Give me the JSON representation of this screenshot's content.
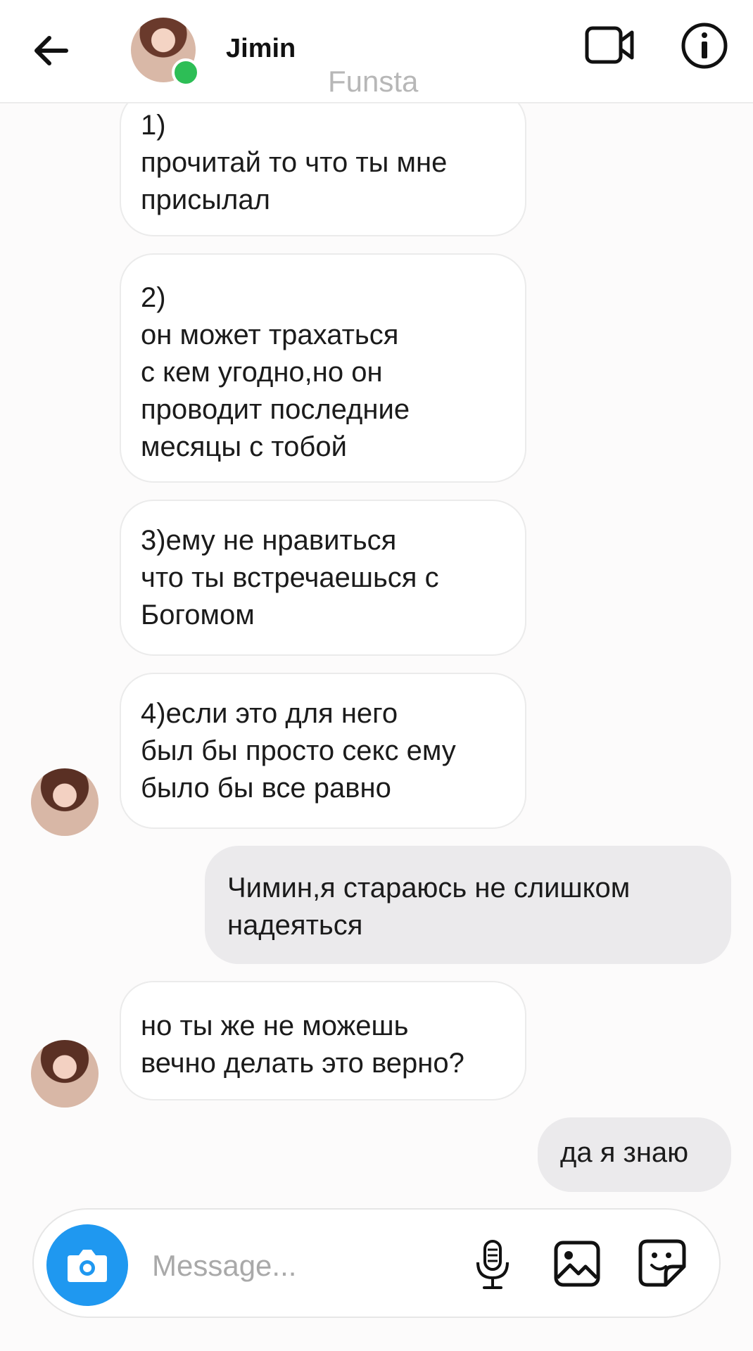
{
  "header": {
    "name": "Jimin",
    "subtitle": "Funsta",
    "icons": {
      "back": "arrow-left-icon",
      "video": "video-camera-icon",
      "info": "info-icon"
    },
    "online": true
  },
  "messages": [
    {
      "side": "in",
      "text": "1)\nпрочитай то что ты мне\nприсылал"
    },
    {
      "side": "in",
      "text": "2)\nон может трахаться\nс кем угодно,но он\nпроводит последние\nмесяцы с тобой"
    },
    {
      "side": "in",
      "text": "3)ему не нравиться\nчто ты встречаешься с\nБогомом"
    },
    {
      "side": "in",
      "text": "4)если это для него\nбыл бы просто секс ему\nбыло бы все равно"
    },
    {
      "side": "out",
      "text": "Чимин,я стараюсь не  слишком\nнадеяться"
    },
    {
      "side": "in",
      "text": "но ты же не можешь\nвечно делать это верно?"
    },
    {
      "side": "out",
      "text": "да я знаю"
    }
  ],
  "composer": {
    "placeholder": "Message...",
    "icons": {
      "camera": "camera-icon",
      "mic": "microphone-icon",
      "gallery": "gallery-icon",
      "sticker": "sticker-icon"
    }
  },
  "colors": {
    "accent": "#1f98f0",
    "online": "#2dbe56",
    "incoming_bubble": "#ffffff",
    "outgoing_bubble": "#ebeaec"
  }
}
